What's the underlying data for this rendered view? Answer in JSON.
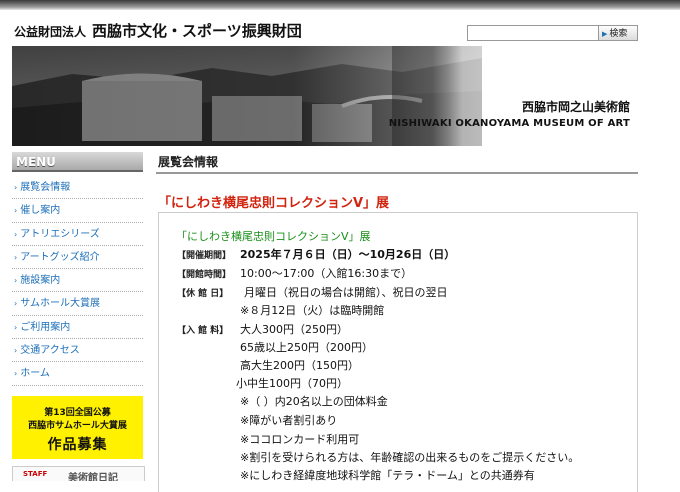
{
  "header": {
    "org_prefix": "公益財団法人",
    "org_name": "西脇市文化・スポーツ振興財団",
    "search": {
      "placeholder": "",
      "value": "",
      "button_label": "検索"
    }
  },
  "banner": {
    "museum_name_jp": "西脇市岡之山美術館",
    "museum_name_en": "NISHIWAKI OKANOYAMA MUSEUM OF ART"
  },
  "sidebar": {
    "menu_title": "MENU",
    "items": [
      {
        "label": "展覧会情報"
      },
      {
        "label": "催し案内"
      },
      {
        "label": "アトリエシリーズ"
      },
      {
        "label": "アートグッズ紹介"
      },
      {
        "label": "施設案内"
      },
      {
        "label": "サムホール大賞展"
      },
      {
        "label": "ご利用案内"
      },
      {
        "label": "交通アクセス"
      },
      {
        "label": "ホーム"
      }
    ],
    "promo": {
      "line1": "第13回全国公募",
      "line2": "西脇市サムホール大賞展",
      "line3": "作品募集"
    },
    "staff_banner": {
      "tag": "STAFF",
      "text": "美術館日記"
    }
  },
  "main": {
    "section_title": "展覧会情報",
    "exhibition_title": "「にしわき横尾忠則コレクションV」展",
    "box_title": "「にしわき横尾忠則コレクションV」展",
    "details": {
      "period_label": "【開催期間】",
      "period_value": "2025年７月６日（日）〜10月26日（日）",
      "hours_label": "【開館時間】",
      "hours_value": "10:00〜17:00（入館16:30まで）",
      "closed_label": "【休 館 日】",
      "closed_value": "月曜日（祝日の場合は開館）、祝日の翌日",
      "closed_note": "※８月12日（火）は臨時開館",
      "fee_label": "【入 館 料】",
      "fees": [
        "大人300円（250円）",
        "65歳以上250円（200円）",
        "高大生200円（150円）",
        "小中生100円（70円）"
      ],
      "notes": [
        "※（ ）内20名以上の団体料金",
        "※障がい者割引あり",
        "※ココロンカード利用可",
        "※割引を受けられる方は、年齢確認の出来るものをご提示ください。",
        "※にしわき経緯度地球科学館「テラ・ドーム」との共通券有"
      ]
    }
  },
  "colors": {
    "link_blue": "#1d6fb8",
    "exhibition_red": "#d2230f",
    "box_title_green": "#1a8f1a",
    "promo_yellow": "#fff100"
  },
  "icons": {
    "menu_bullet": "›",
    "search_button_arrow": "▶"
  }
}
